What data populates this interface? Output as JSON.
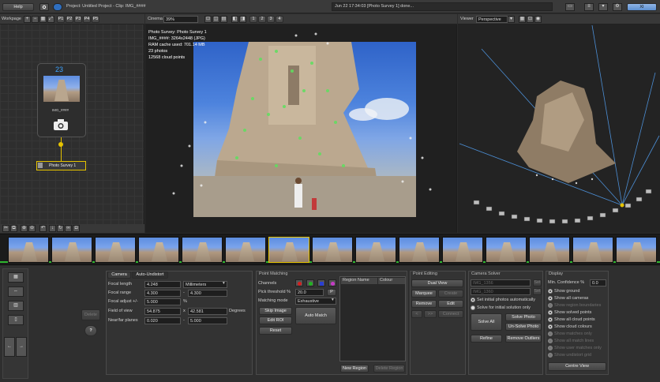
{
  "top_bar": {
    "help_label": "Help",
    "project_title": "Project: Untitled Project - Clip: IMG_####",
    "status_text": "Jun 22 17:34:03 [Photo Survey 1] done...",
    "right_btn_label": "XI"
  },
  "workpage": {
    "label": "Workpage",
    "tabs": [
      "P1",
      "P2",
      "P3",
      "P4",
      "P5"
    ]
  },
  "node": {
    "count": "23",
    "thumb_label": "IMG_####",
    "survey_label": "Photo Survey 1"
  },
  "cinema": {
    "label": "Cinema",
    "zoom": "39%",
    "view_tabs": [
      "1",
      "2",
      "3",
      "4"
    ],
    "info_lines": [
      "Photo Survey: Photo Survey 1",
      "IMG_####: 3264x2448 (JPG)",
      "RAM cache used: 701.14 MB",
      "23 photos",
      "12568 cloud points"
    ]
  },
  "viewer": {
    "label": "Viewer",
    "mode": "Perspective"
  },
  "camera_tabs": [
    "Camera",
    "Auto-Undistort"
  ],
  "camera": {
    "focal_length_label": "Focal length",
    "focal_length": "4.248",
    "unit": "Millimeters",
    "focal_range_label": "Focal range",
    "focal_range_min": "4.300",
    "focal_range_max": "4.300",
    "focal_adjust_label": "Focal adjust +/-",
    "focal_adjust": "5.000",
    "focal_adjust_unit": "%",
    "fov_label": "Field of view",
    "fov_x": "54.875",
    "fov_sep": "x",
    "fov_y": "42.581",
    "fov_unit": "Degrees",
    "planes_label": "Near/far planes",
    "near": "0.020",
    "planes_sep": "-",
    "far": "5.000"
  },
  "left_side": {
    "delete_label": "Delete",
    "help_icon": "?"
  },
  "point_matching": {
    "title": "Point Matching",
    "channels_label": "Channels",
    "pick_threshold_label": "Pick threshold %",
    "pick_threshold": "20.0",
    "p_label": "P",
    "matching_mode_label": "Matching mode",
    "matching_mode": "Exhaustive",
    "skip_image": "Skip Image",
    "edit_roi": "Edit ROI",
    "reset": "Reset",
    "auto_match": "Auto Match",
    "col_region_name": "Region Name",
    "col_colour": "Colour",
    "new_region": "New Region",
    "delete_region": "Delete Region",
    "channel_colors": [
      "#d42020",
      "#22b322",
      "#2a3fd0",
      "#c63ac6"
    ]
  },
  "point_editing": {
    "title": "Point Editing",
    "dual_view": "Dual View",
    "marquee": "Marquee",
    "create": "Create",
    "remove": "Remove",
    "edit": "Edit",
    "left_arrow": "<",
    "right_arrow": ">>",
    "connect": "Connect"
  },
  "camera_solver": {
    "title": "Camera Solver",
    "field1": "IMG_1356",
    "field2": "IMG_1360",
    "set_btn": "Set",
    "set_initial": "Set initial photos automatically",
    "solve_initial": "Solve for initial solution only",
    "solve_all": "Solve All",
    "solve_photo": "Solve Photo",
    "unsolve_photo": "Un-Solve Photo",
    "refine": "Refine",
    "remove_outliers": "Remove Outliers"
  },
  "display": {
    "title": "Display",
    "min_conf_label": "Min. Confidence %",
    "min_conf": "0.0",
    "options": [
      {
        "label": "Show ground",
        "on": true,
        "enabled": true
      },
      {
        "label": "Show all cameras",
        "on": true,
        "enabled": true
      },
      {
        "label": "Show region boundaries",
        "on": false,
        "enabled": false
      },
      {
        "label": "Show solved points",
        "on": true,
        "enabled": true
      },
      {
        "label": "Show all cloud points",
        "on": true,
        "enabled": true
      },
      {
        "label": "Show cloud colours",
        "on": true,
        "enabled": true
      },
      {
        "label": "Show matches only",
        "on": false,
        "enabled": false
      },
      {
        "label": "Show all match lines",
        "on": false,
        "enabled": false
      },
      {
        "label": "Show user matches only",
        "on": false,
        "enabled": false
      },
      {
        "label": "Show undistort grid",
        "on": false,
        "enabled": false
      }
    ],
    "centre_view": "Centre View"
  }
}
